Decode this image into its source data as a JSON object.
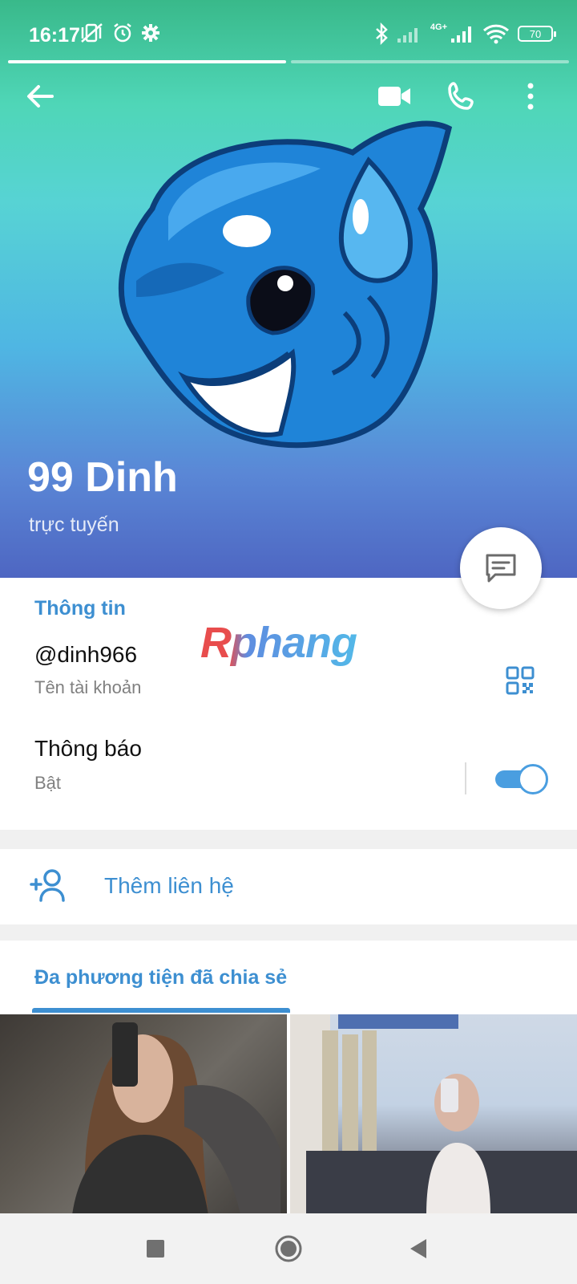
{
  "status_bar": {
    "time": "16:17",
    "battery": "70",
    "network": "4G+"
  },
  "toolbar": {
    "back_icon": "arrow-left-icon",
    "video_icon": "video-camera-icon",
    "call_icon": "phone-icon",
    "more_icon": "more-vertical-icon"
  },
  "profile": {
    "name": "99 Dinh",
    "status": "trực tuyến",
    "avatar": "blue-whale-sticker"
  },
  "info": {
    "section_title": "Thông tin",
    "username": "@dinh966",
    "username_caption": "Tên tài khoản",
    "notifications_label": "Thông báo",
    "notifications_value": "Bật",
    "notifications_on": true,
    "watermark": "Rphang"
  },
  "actions": {
    "add_contact": "Thêm liên hệ"
  },
  "media": {
    "section_title": "Đa phương tiện đã chia sẻ"
  },
  "colors": {
    "accent": "#3d8fd1",
    "toggle": "#4a9ee0"
  }
}
